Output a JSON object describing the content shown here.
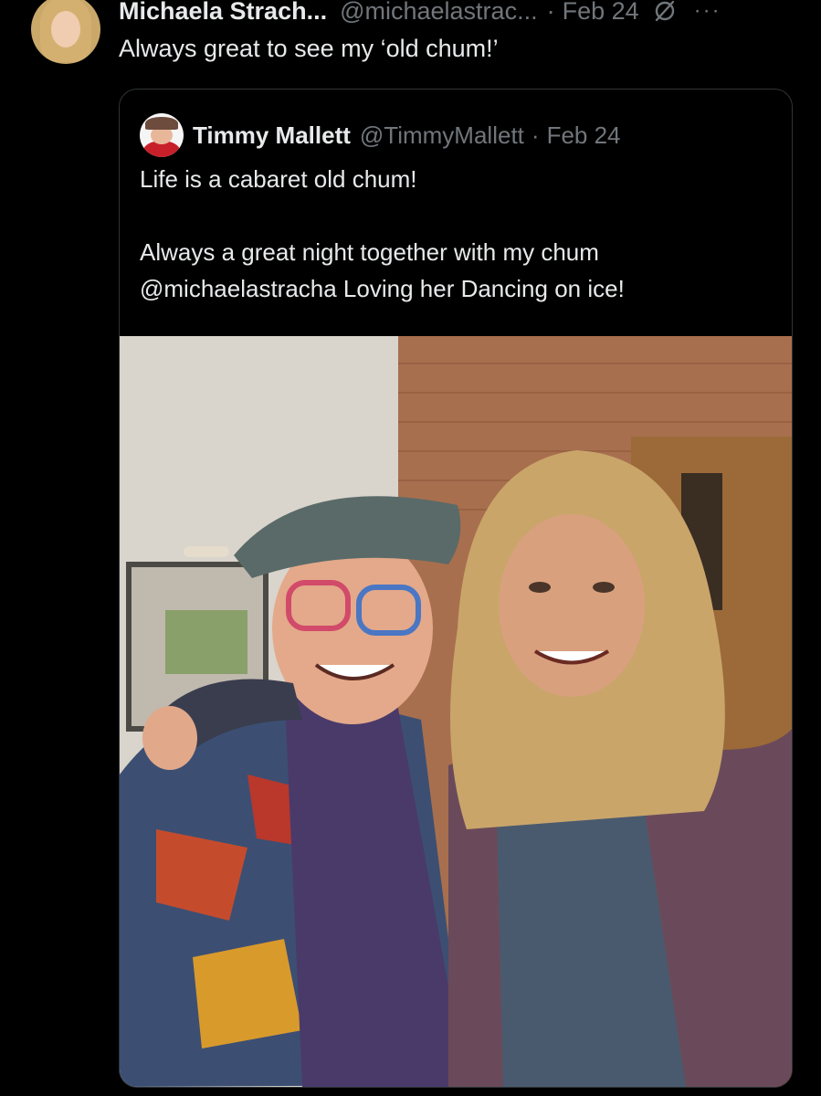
{
  "post": {
    "author_name": "Michaela Strach...",
    "author_handle": "@michaelastrac...",
    "separator": "·",
    "date": "Feb 24",
    "more": "···",
    "text": "Always great to see my ‘old chum!’"
  },
  "quoted": {
    "author_name": "Timmy Mallett",
    "author_handle": "@TimmyMallett",
    "separator": "·",
    "date": "Feb 24",
    "line1": "Life is a cabaret old chum!",
    "line2": "Always a great night together with my chum",
    "line3": "@michaelastracha  Loving her Dancing on ice!"
  },
  "icons": {
    "grok": "grok-icon",
    "more": "more-options-icon"
  },
  "colors": {
    "background": "#000000",
    "text": "#e7e9ea",
    "muted": "#71767b",
    "border": "#2f3336"
  }
}
